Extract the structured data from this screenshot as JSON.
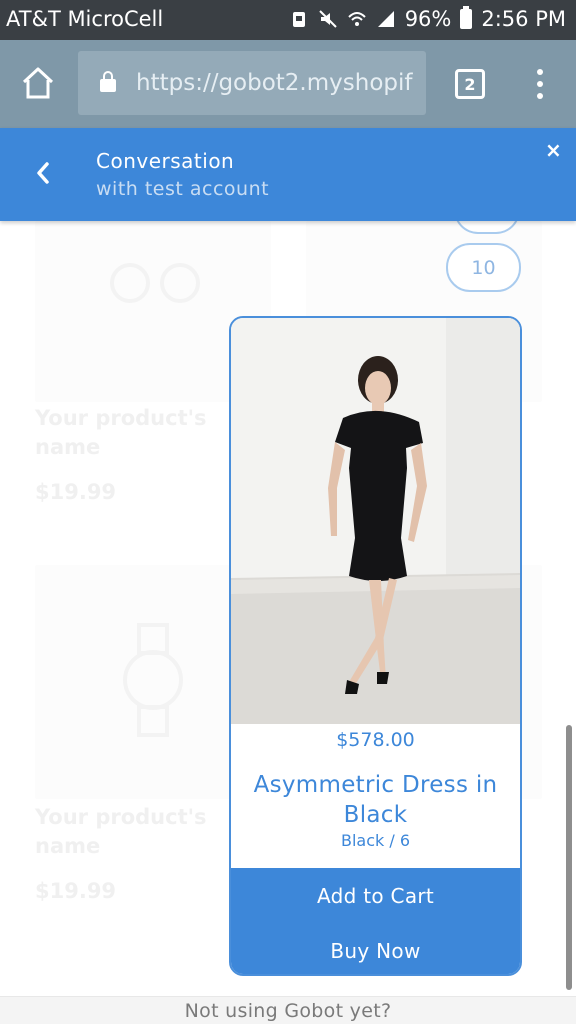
{
  "status_bar": {
    "carrier": "AT&T MicroCell",
    "battery": "96%",
    "time": "2:56 PM"
  },
  "browser": {
    "url": "https://gobot2.myshopif",
    "tab_count": "2"
  },
  "conversation": {
    "title": "Conversation",
    "subtitle": "with test account",
    "close_label": "×"
  },
  "background_shop": {
    "products": [
      {
        "name": "Your product's name",
        "price": "$19.99"
      },
      {
        "name": "Your product's name",
        "price": "$19.99"
      }
    ]
  },
  "quick_replies": [
    "10"
  ],
  "product_card": {
    "price": "$578.00",
    "name": "Asymmetric Dress in Black",
    "variant": "Black / 6",
    "add_to_cart_label": "Add to Cart",
    "buy_now_label": "Buy Now"
  },
  "footer": {
    "text": "Not using Gobot yet?"
  },
  "colors": {
    "accent": "#3d87d9",
    "browser_bar": "#7f98a8",
    "status_bar": "#3a3f44"
  }
}
